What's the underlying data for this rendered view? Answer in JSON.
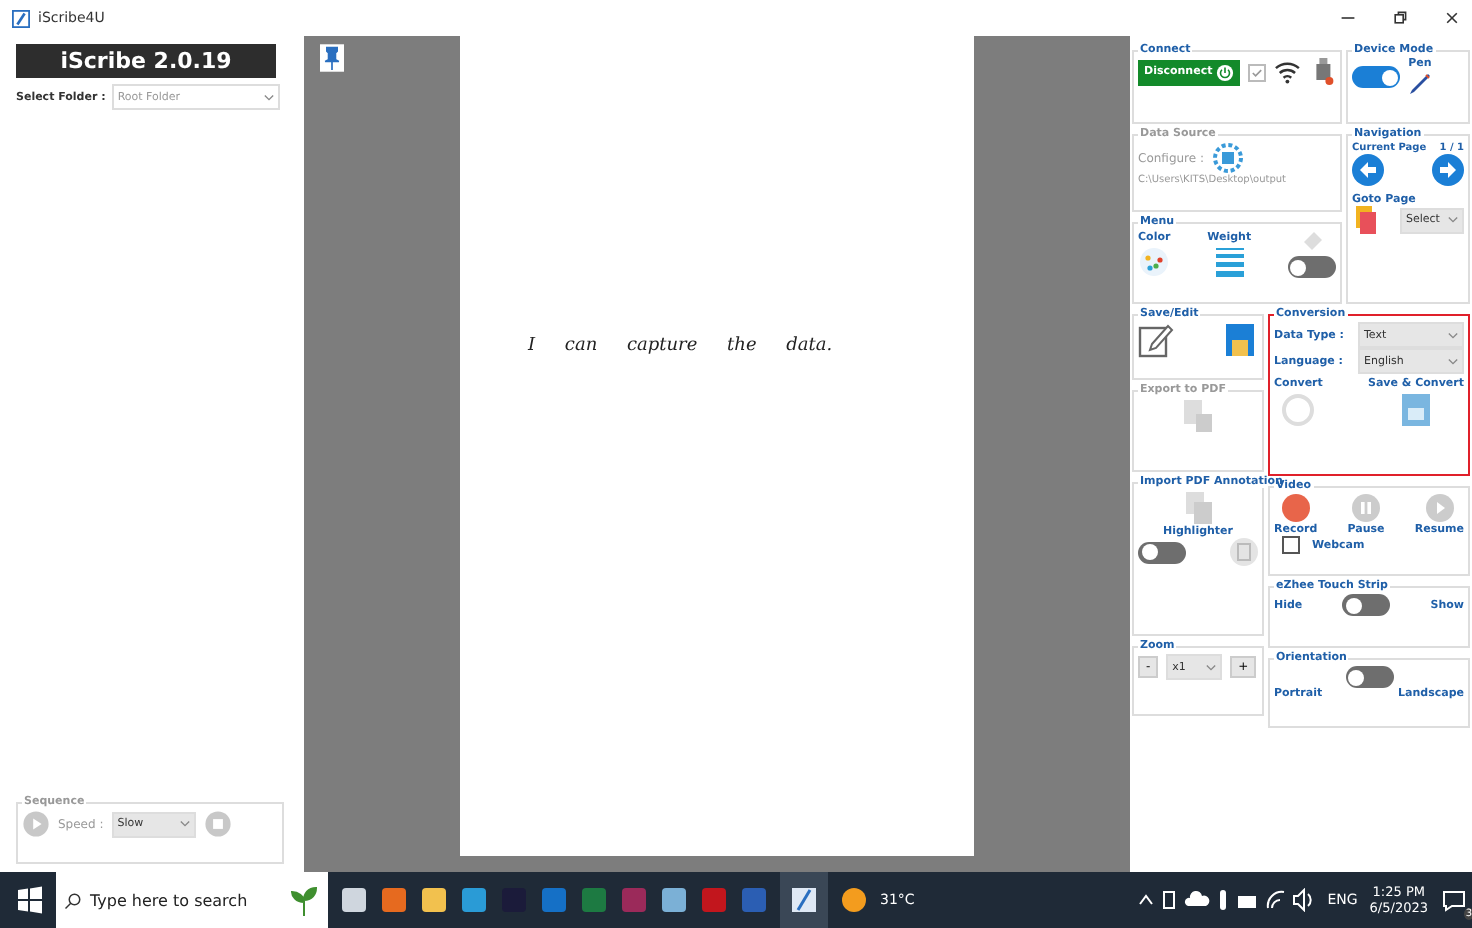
{
  "window": {
    "title": "iScribe4U"
  },
  "sidebar": {
    "app_title": "iScribe 2.0.19",
    "folder_label": "Select Folder :",
    "folder_value": "Root Folder"
  },
  "sequence": {
    "title": "Sequence",
    "speed_label": "Speed :",
    "speed_value": "Slow"
  },
  "page": {
    "handwriting": "I can capture the data."
  },
  "connect": {
    "title": "Connect",
    "button": "Disconnect",
    "checked": true
  },
  "device_mode": {
    "title": "Device Mode",
    "label": "Pen",
    "on": true
  },
  "data_source": {
    "title": "Data Source",
    "configure": "Configure :",
    "path": "C:\\Users\\KITS\\Desktop\\output"
  },
  "navigation": {
    "title": "Navigation",
    "current_label": "Current Page",
    "page": "1 / 1",
    "goto_title": "Goto Page",
    "goto_value": "Select"
  },
  "menu": {
    "title": "Menu",
    "color_label": "Color",
    "weight_label": "Weight",
    "on": false
  },
  "save_edit": {
    "title": "Save/Edit"
  },
  "conversion": {
    "title": "Conversion",
    "data_type_label": "Data Type :",
    "data_type": "Text",
    "language_label": "Language :",
    "language": "English",
    "convert": "Convert",
    "save_convert": "Save & Convert"
  },
  "export_pdf": {
    "title": "Export to PDF"
  },
  "import_pdf": {
    "title": "Import PDF Annotation",
    "highlighter": "Highlighter",
    "on": false
  },
  "video": {
    "title": "Video",
    "record": "Record",
    "pause": "Pause",
    "resume": "Resume",
    "webcam": "Webcam",
    "webcam_checked": false
  },
  "touch_strip": {
    "title": "eZhee Touch Strip",
    "hide": "Hide",
    "show": "Show",
    "on": false
  },
  "zoom": {
    "title": "Zoom",
    "minus": "-",
    "value": "x1",
    "plus": "+"
  },
  "orientation": {
    "title": "Orientation",
    "portrait": "Portrait",
    "landscape": "Landscape",
    "on": false
  },
  "taskbar": {
    "search_placeholder": "Type here to search",
    "temperature": "31°C",
    "language": "ENG",
    "time": "1:25 PM",
    "date": "6/5/2023",
    "notifications": "3"
  }
}
